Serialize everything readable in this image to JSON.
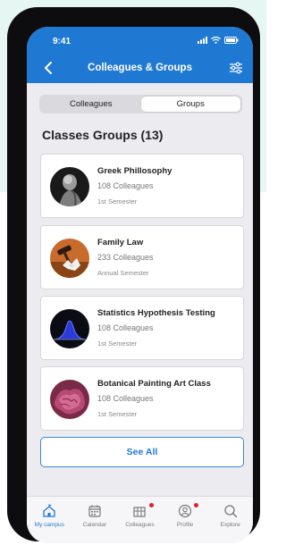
{
  "status": {
    "time": "9:41"
  },
  "header": {
    "title": "Colleagues & Groups"
  },
  "segments": {
    "colleagues": "Colleagues",
    "groups": "Groups",
    "active": "Groups"
  },
  "section": {
    "title": "Classes Groups (13)"
  },
  "groups": [
    {
      "name": "Greek Phillosophy",
      "count": "108 Colleagues",
      "semester": "1st Semester",
      "icon": "statue-image"
    },
    {
      "name": "Family Law",
      "count": "233 Colleagues",
      "semester": "Annual Semester",
      "icon": "gavel-image"
    },
    {
      "name": "Statistics Hypothesis Testing",
      "count": "108 Colleagues",
      "semester": "1st Semester",
      "icon": "bell-curve-image"
    },
    {
      "name": "Botanical Painting Art Class",
      "count": "108 Colleagues",
      "semester": "1st Semester",
      "icon": "flower-image"
    }
  ],
  "see_all": "See All",
  "tabbar": {
    "items": [
      {
        "label": "My campus",
        "icon": "campus-icon",
        "active": true
      },
      {
        "label": "Calendar",
        "icon": "calendar-icon"
      },
      {
        "label": "Colleagues",
        "icon": "colleagues-icon"
      },
      {
        "label": "Profile",
        "icon": "profile-icon"
      },
      {
        "label": "Explore",
        "icon": "search-icon"
      }
    ]
  },
  "colors": {
    "accent": "#1f78d1",
    "badge": "#e0202a",
    "background": "#e5f6f3"
  }
}
